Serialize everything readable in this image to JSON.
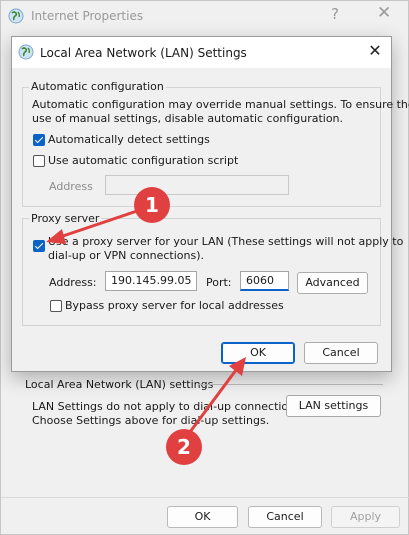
{
  "parent_window": {
    "title": "Internet Properties",
    "help_glyph": "?",
    "close_glyph": "✕",
    "lan_section_label": "Local Area Network (LAN) settings",
    "lan_desc_line1": "LAN Settings do not apply to dial-up connections.",
    "lan_desc_line2": "Choose Settings above for dial-up settings.",
    "lan_settings_button": "LAN settings",
    "ok_button": "OK",
    "cancel_button": "Cancel",
    "apply_button": "Apply"
  },
  "dialog": {
    "title": "Local Area Network (LAN) Settings",
    "close_glyph": "✕",
    "auto_config": {
      "legend": "Automatic configuration",
      "desc_line1": "Automatic configuration may override manual settings.  To ensure the",
      "desc_line2": "use of manual settings, disable automatic configuration.",
      "auto_detect_label": "Automatically detect settings",
      "auto_detect_checked": true,
      "script_label": "Use automatic configuration script",
      "script_checked": false,
      "address_label": "Address",
      "address_value": ""
    },
    "proxy": {
      "legend": "Proxy server",
      "use_proxy_line1": "Use a proxy server for your LAN (These settings will not apply to",
      "use_proxy_line2": "dial-up or VPN connections).",
      "use_proxy_checked": true,
      "address_label": "Address:",
      "address_value": "190.145.99.05",
      "port_label": "Port:",
      "port_value": "6060",
      "advanced_button": "Advanced",
      "bypass_label": "Bypass proxy server for local addresses",
      "bypass_checked": false
    },
    "ok_button": "OK",
    "cancel_button": "Cancel"
  },
  "annotations": {
    "badge_1": "1",
    "badge_2": "2",
    "color": "#e04040"
  },
  "colors": {
    "accent": "#0b63c8",
    "window_bg": "#f0f0f0"
  }
}
